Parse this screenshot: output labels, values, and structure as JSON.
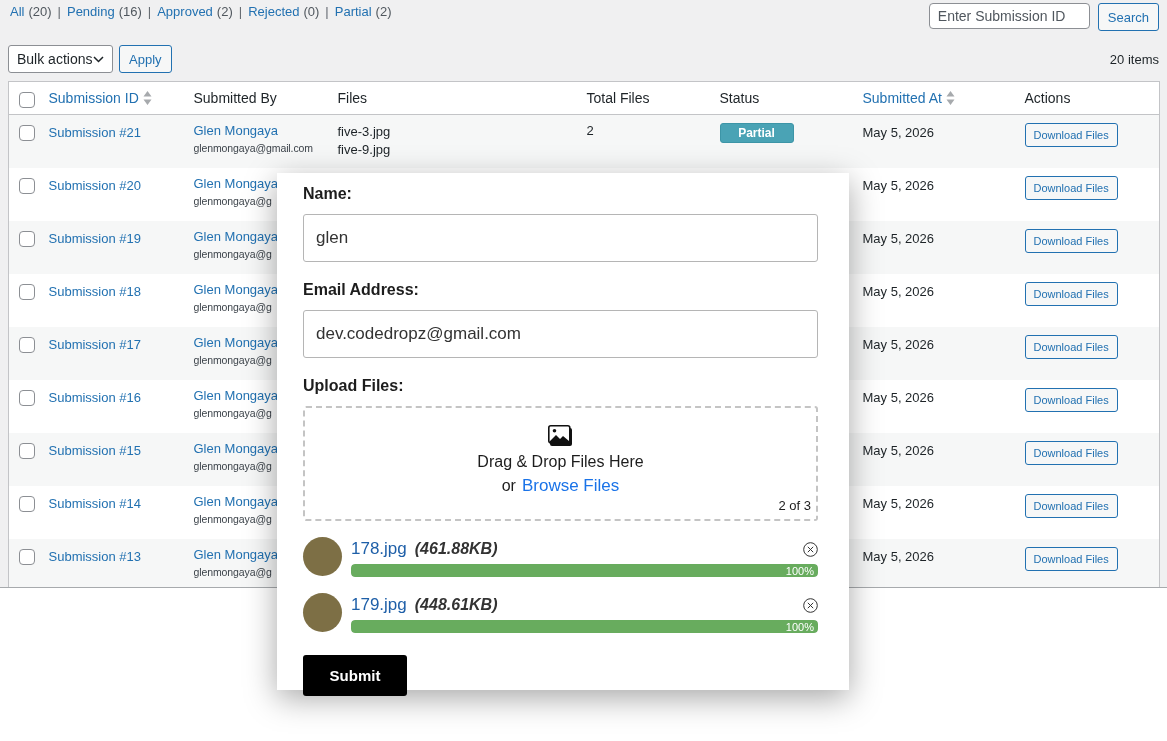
{
  "filters": [
    {
      "label": "All",
      "count": "(20)"
    },
    {
      "label": "Pending",
      "count": "(16)"
    },
    {
      "label": "Approved",
      "count": "(2)"
    },
    {
      "label": "Rejected",
      "count": "(0)"
    },
    {
      "label": "Partial",
      "count": "(2)"
    }
  ],
  "filter_separator": "|",
  "search": {
    "placeholder": "Enter Submission ID",
    "button": "Search"
  },
  "bulk_actions": {
    "value": "Bulk actions",
    "apply": "Apply"
  },
  "item_count": "20 items",
  "table": {
    "select_all_checked": false,
    "columns": [
      {
        "label": "Submission ID",
        "sortable": true
      },
      {
        "label": "Submitted By",
        "sortable": false
      },
      {
        "label": "Files",
        "sortable": false
      },
      {
        "label": "Total Files",
        "sortable": false
      },
      {
        "label": "Status",
        "sortable": false
      },
      {
        "label": "Submitted At",
        "sortable": true
      },
      {
        "label": "Actions",
        "sortable": false
      }
    ],
    "rows": [
      {
        "checked": false,
        "id": "Submission #21",
        "name": "Glen Mongaya",
        "email": "glenmongaya@gmail.com",
        "files": [
          "five-3.jpg",
          "five-9.jpg"
        ],
        "total": "2",
        "status": "Partial",
        "date": "May 5, 2026",
        "action": "Download Files"
      },
      {
        "checked": false,
        "id": "Submission #20",
        "name": "Glen Mongaya",
        "email": "glenmongaya@g",
        "date": "May 5, 2026",
        "action": "Download Files"
      },
      {
        "checked": false,
        "id": "Submission #19",
        "name": "Glen Mongaya",
        "email": "glenmongaya@g",
        "date": "May 5, 2026",
        "action": "Download Files"
      },
      {
        "checked": false,
        "id": "Submission #18",
        "name": "Glen Mongaya",
        "email": "glenmongaya@g",
        "date": "May 5, 2026",
        "action": "Download Files"
      },
      {
        "checked": false,
        "id": "Submission #17",
        "name": "Glen Mongaya",
        "email": "glenmongaya@g",
        "date": "May 5, 2026",
        "action": "Download Files"
      },
      {
        "checked": false,
        "id": "Submission #16",
        "name": "Glen Mongaya",
        "email": "glenmongaya@g",
        "date": "May 5, 2026",
        "action": "Download Files"
      },
      {
        "checked": false,
        "id": "Submission #15",
        "name": "Glen Mongaya",
        "email": "glenmongaya@g",
        "date": "May 5, 2026",
        "action": "Download Files"
      },
      {
        "checked": false,
        "id": "Submission #14",
        "name": "Glen Mongaya",
        "email": "glenmongaya@g",
        "date": "May 5, 2026",
        "action": "Download Files"
      },
      {
        "checked": false,
        "id": "Submission #13",
        "name": "Glen Mongaya",
        "email": "glenmongaya@g",
        "date": "May 5, 2026",
        "action": "Download Files"
      }
    ]
  },
  "form": {
    "fields": [
      {
        "label": "Name:",
        "value": "glen"
      },
      {
        "label": "Email Address:",
        "value": "dev.codedropz@gmail.com"
      }
    ],
    "upload": {
      "label": "Upload Files:",
      "prompt": "Drag & Drop Files Here",
      "or": "or",
      "browse": "Browse Files",
      "counter": "2 of 3"
    },
    "files": [
      {
        "name": "178.jpg",
        "size": "(461.88KB)",
        "level": 1,
        "percent": "100%"
      },
      {
        "name": "179.jpg",
        "size": "(448.61KB)",
        "level": 1,
        "percent": "100%"
      }
    ],
    "submit": "Submit"
  }
}
